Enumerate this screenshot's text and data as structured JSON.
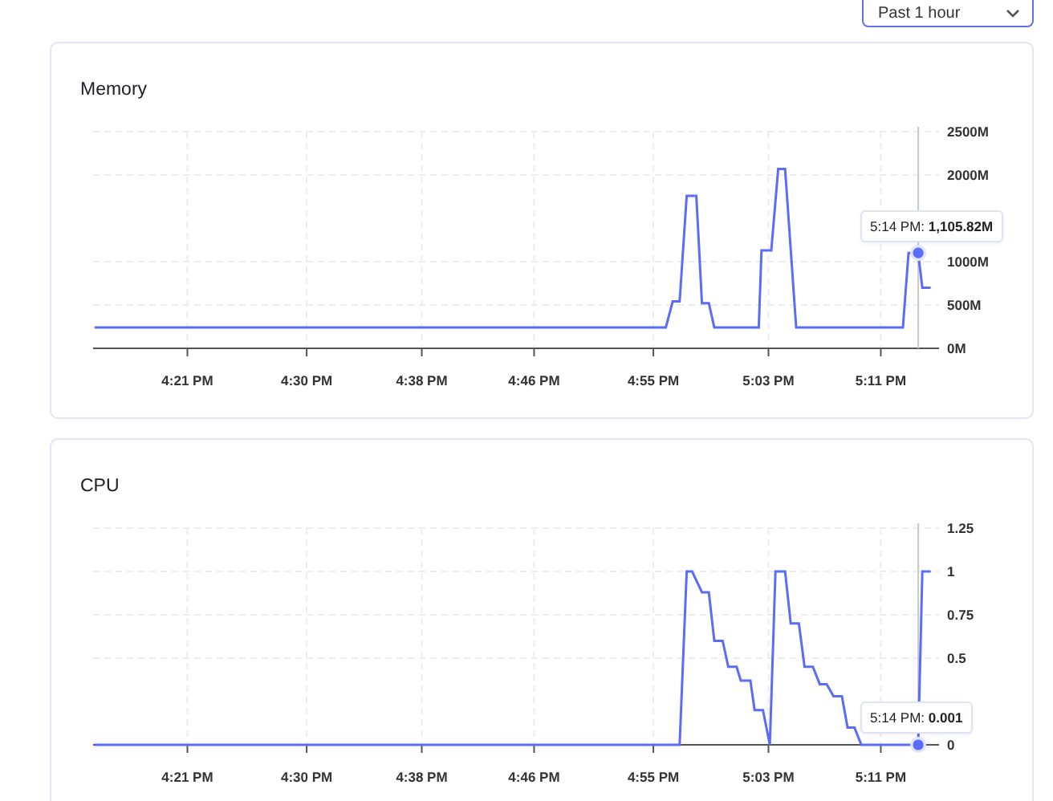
{
  "range_select": {
    "value": "Past 1 hour"
  },
  "panels": [
    {
      "title": "Memory",
      "chart_data": {
        "type": "line",
        "grid": true,
        "x": [
          974.7,
          1015.9,
          1016.4,
          1016.9,
          1017.4,
          1018.1,
          1018.5,
          1019.0,
          1019.4,
          1022.6,
          1022.8,
          1023.5,
          1024.0,
          1024.5,
          1025.3,
          1033.0,
          1033.4,
          1034.1,
          1034.4,
          1035.0
        ],
        "series": [
          {
            "color": "#5b6cf6",
            "values": [
              240,
              240,
              540,
              540,
              1760,
              1760,
              520,
              520,
              240,
              240,
              1130,
              1130,
              2070,
              2070,
              240,
              240,
              1100,
              1100,
              700,
              700
            ]
          }
        ],
        "xlim": [
          974.6,
          1035.6
        ],
        "ylim": [
          0,
          2500
        ],
        "xticks": [
          {
            "value": 981.4,
            "label": "4:21 PM"
          },
          {
            "value": 990,
            "label": "4:30 PM"
          },
          {
            "value": 998.3,
            "label": "4:38 PM"
          },
          {
            "value": 1006.4,
            "label": "4:46 PM"
          },
          {
            "value": 1015,
            "label": "4:55 PM"
          },
          {
            "value": 1023.3,
            "label": "5:03 PM"
          },
          {
            "value": 1031.4,
            "label": "5:11 PM"
          }
        ],
        "yticks": [
          {
            "value": 0,
            "label": "0M"
          },
          {
            "value": 500,
            "label": "500M"
          },
          {
            "value": 1000,
            "label": "1000M"
          },
          {
            "value": 2000,
            "label": "2000M"
          },
          {
            "value": 2500,
            "label": "2500M"
          }
        ],
        "annotations": [
          {
            "x": 1034.1,
            "y": 1100,
            "text": "5:14 PM: **1,105.82M**"
          }
        ]
      }
    },
    {
      "title": "CPU",
      "chart_data": {
        "type": "line",
        "grid": true,
        "x": [
          974.7,
          1016.9,
          1017.4,
          1017.8,
          1018.5,
          1019.0,
          1019.4,
          1020.0,
          1020.4,
          1021.0,
          1021.3,
          1022.0,
          1022.3,
          1022.9,
          1023.4,
          1023.8,
          1024.5,
          1024.9,
          1025.5,
          1025.9,
          1026.5,
          1027.0,
          1027.5,
          1028.0,
          1028.6,
          1029.0,
          1029.5,
          1030.0,
          1034.1,
          1034.4,
          1035.0
        ],
        "series": [
          {
            "color": "#5b6cf6",
            "values": [
              0,
              0,
              1,
              1,
              0.88,
              0.88,
              0.6,
              0.6,
              0.45,
              0.45,
              0.37,
              0.37,
              0.2,
              0.2,
              0,
              1,
              1,
              0.7,
              0.7,
              0.45,
              0.45,
              0.35,
              0.35,
              0.28,
              0.28,
              0.1,
              0.1,
              0,
              0,
              1,
              1
            ]
          }
        ],
        "xlim": [
          974.6,
          1035.6
        ],
        "ylim": [
          0,
          1.25
        ],
        "xticks": [
          {
            "value": 981.4,
            "label": "4:21 PM"
          },
          {
            "value": 990,
            "label": "4:30 PM"
          },
          {
            "value": 998.3,
            "label": "4:38 PM"
          },
          {
            "value": 1006.4,
            "label": "4:46 PM"
          },
          {
            "value": 1015,
            "label": "4:55 PM"
          },
          {
            "value": 1023.3,
            "label": "5:03 PM"
          },
          {
            "value": 1031.4,
            "label": "5:11 PM"
          }
        ],
        "yticks": [
          {
            "value": 0,
            "label": "0"
          },
          {
            "value": 0.5,
            "label": "0.5"
          },
          {
            "value": 0.75,
            "label": "0.75"
          },
          {
            "value": 1,
            "label": "1"
          },
          {
            "value": 1.25,
            "label": "1.25"
          }
        ],
        "annotations": [
          {
            "x": 1034.1,
            "y": 0,
            "text": "5:14 PM: **0.001**"
          }
        ]
      }
    }
  ]
}
